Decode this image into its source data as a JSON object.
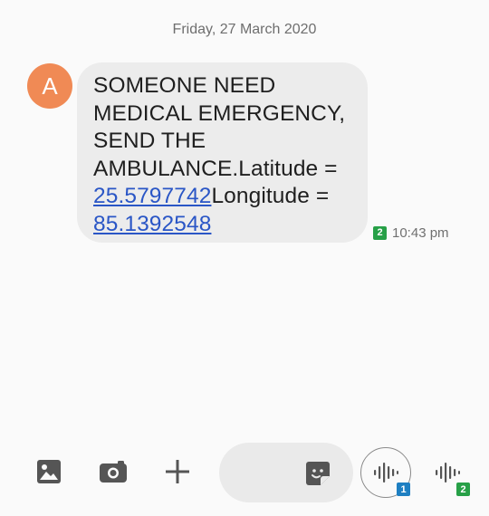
{
  "conversation": {
    "date_header": "Friday, 27 March 2020"
  },
  "message": {
    "sender_initial": "A",
    "avatar_color": "#f08a55",
    "text_line1": "SOMEONE NEED",
    "text_line2": "MEDICAL EMERGENCY,",
    "text_line3": "SEND THE",
    "text_line4": "AMBULANCE.Latitude =",
    "latitude": "25.5797742",
    "longitude_label": "Longitude =",
    "longitude": "85.1392548",
    "sim_badge": "2",
    "time": "10:43 pm"
  },
  "composer": {
    "gallery_icon": "image-icon",
    "camera_icon": "camera-icon",
    "add_icon": "plus-icon",
    "sticker_icon": "sticker-icon",
    "voice_sim1_badge": "1",
    "voice_sim2_badge": "2"
  },
  "colors": {
    "link": "#2a56c6",
    "sim1": "#1e7fc2",
    "sim2": "#27a047",
    "bubble": "#ececec"
  }
}
